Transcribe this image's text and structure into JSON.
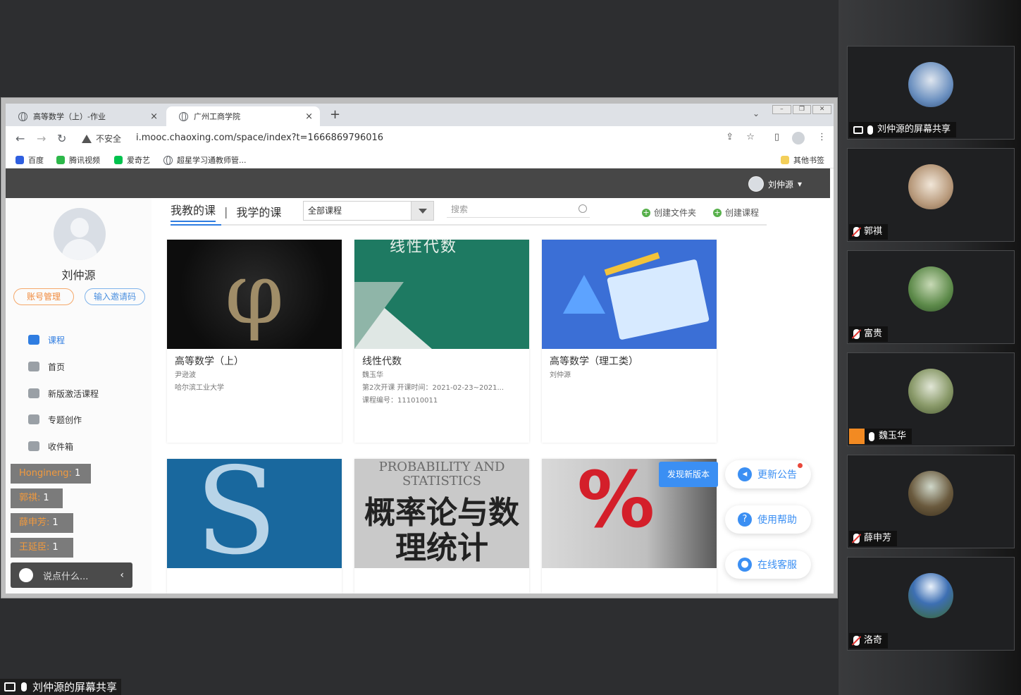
{
  "browser": {
    "tabs": [
      {
        "label": "高等数学（上）-作业",
        "active": false
      },
      {
        "label": "广州工商学院",
        "active": true
      }
    ],
    "url": "i.mooc.chaoxing.com/space/index?t=1666869796016",
    "security_label": "不安全",
    "bookmarks": [
      "百度",
      "腾讯视频",
      "爱奇艺",
      "超星学习通教师管...",
      "其他书签"
    ]
  },
  "page": {
    "top_user": "刘仲源",
    "sidebar": {
      "name": "刘仲源",
      "account_btn": "账号管理",
      "invite_btn": "输入邀请码",
      "menu": [
        "课程",
        "首页",
        "新版激活课程",
        "专题创作",
        "收件箱"
      ]
    },
    "tabs": {
      "teach": "我教的课",
      "learn": "我学的课"
    },
    "filter_selected": "全部课程",
    "search_placeholder": "搜索",
    "create_folder": "创建文件夹",
    "create_course": "创建课程",
    "courses": [
      {
        "title": "高等数学（上）",
        "teacher": "尹逊波",
        "line2": "哈尔滨工业大学",
        "line3": ""
      },
      {
        "title": "线性代数",
        "teacher": "魏玉华",
        "line2": "第2次开课 开课时间：2021-02-23~2021...",
        "line3": "课程编号：111010011"
      },
      {
        "title": "高等数学（理工类）",
        "teacher": "刘仲源",
        "line2": "",
        "line3": ""
      }
    ],
    "cover_texts": {
      "linear": "线性代数",
      "prob_en": "PROBABILITY AND STATISTICS",
      "prob_cn": "概率论与数理统计"
    },
    "float": {
      "new_version": "发现新版本",
      "announce": "更新公告",
      "help": "使用帮助",
      "service": "在线客服"
    }
  },
  "chat": {
    "messages": [
      {
        "name": "Hongineng:",
        "count": "1"
      },
      {
        "name": "郭祺:",
        "count": "1"
      },
      {
        "name": "薛申芳:",
        "count": "1"
      },
      {
        "name": "王延臣:",
        "count": "1"
      }
    ],
    "input_placeholder": "说点什么..."
  },
  "share_label": "刘仲源的屏幕共享",
  "participants": [
    {
      "name": "刘仲源的屏幕共享",
      "muted": false,
      "color": "#6a8fbf"
    },
    {
      "name": "郭祺",
      "muted": true,
      "color": "#b89a7c"
    },
    {
      "name": "富贵",
      "muted": true,
      "color": "#5d8a4a"
    },
    {
      "name": "魏玉华",
      "muted": false,
      "color": "#8a9a6a"
    },
    {
      "name": "薛申芳",
      "muted": true,
      "color": "#6a5a3e"
    },
    {
      "name": "洛奇",
      "muted": true,
      "color": "#3d6fb3"
    }
  ]
}
